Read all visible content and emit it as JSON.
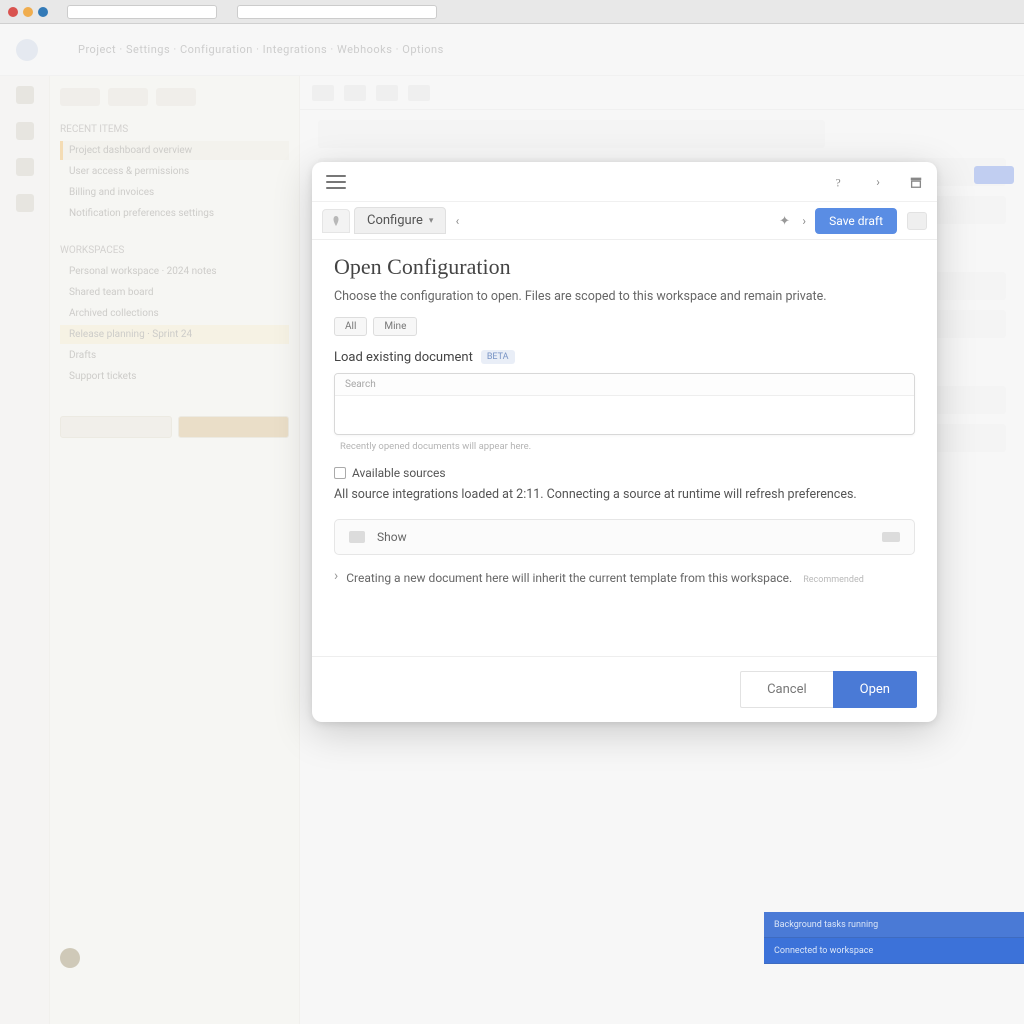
{
  "browser": {
    "tab_title": ""
  },
  "background": {
    "breadcrumb": "Project · Settings · Configuration · Integrations · Webhooks · Options",
    "sidebar": {
      "group1_title": "RECENT ITEMS",
      "items1": [
        "Project dashboard overview",
        "User access & permissions",
        "Billing and invoices",
        "Notification preferences settings"
      ],
      "group2_title": "WORKSPACES",
      "items2": [
        "Personal workspace · 2024 notes",
        "Shared team board",
        "Archived collections",
        "Release planning · Sprint 24",
        "Drafts",
        "Support tickets"
      ]
    },
    "status_bars": {
      "line1": "Background tasks running",
      "line2": "Connected to workspace"
    }
  },
  "modal": {
    "tab_label": "Configure",
    "primary_chip": "Save draft",
    "heading": "Open Configuration",
    "subheading": "Choose the configuration to open. Files are scoped to this workspace and remain private.",
    "chips": {
      "a": "All",
      "b": "Mine"
    },
    "field_label": "Load existing document",
    "field_badge": "BETA",
    "input_placeholder_small": "Search",
    "input_value": "",
    "helper_text": "Recently opened documents will appear here.",
    "section2_label": "Available sources",
    "paragraph": "All source integrations loaded at 2:11. Connecting a source at runtime will refresh preferences.",
    "collapsed_label": "Show",
    "note_text": "Creating a new document here will inherit the current template from this workspace.",
    "note_tag": "Recommended",
    "footer": {
      "secondary": "Cancel",
      "primary": "Open"
    }
  }
}
